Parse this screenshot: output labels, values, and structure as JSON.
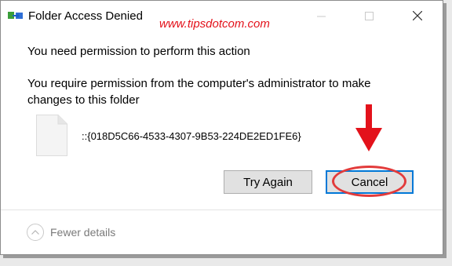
{
  "window": {
    "title": "Folder Access Denied",
    "watermark": "www.tipsdotcom.com"
  },
  "message": {
    "heading": "You need permission to perform this action",
    "description": "You require permission from the computer's administrator to make changes to this folder",
    "folder_id": "::{018D5C66-4533-4307-9B53-224DE2ED1FE6}"
  },
  "buttons": {
    "try_again": "Try Again",
    "cancel": "Cancel"
  },
  "details": {
    "label": "Fewer details"
  },
  "colors": {
    "annotation_red": "#e3121b",
    "focus_blue": "#0078d7"
  }
}
